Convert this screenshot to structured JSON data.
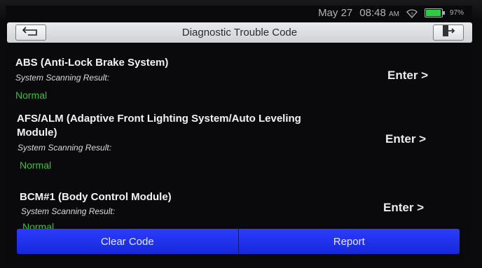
{
  "status_bar": {
    "date": "May 27",
    "time": "08:48",
    "ampm": "AM",
    "battery": "97%"
  },
  "header": {
    "title": "Diagnostic Trouble Code",
    "back_icon": "back-arrow-icon",
    "exit_icon": "exit-door-icon"
  },
  "systems": [
    {
      "name": "ABS (Anti-Lock Brake System)",
      "sub_label": "System Scanning Result:",
      "result": "Normal",
      "enter_label": "Enter >"
    },
    {
      "name_line1": "AFS/ALM (Adaptive Front Lighting System/Auto Leveling",
      "name_line2": "Module)",
      "sub_label": "System Scanning Result:",
      "result": "Normal",
      "enter_label": "Enter >"
    },
    {
      "name": "BCM#1 (Body Control Module)",
      "sub_label": "System Scanning Result:",
      "result": "Normal",
      "enter_label": "Enter >"
    }
  ],
  "actions": {
    "clear_code": "Clear Code",
    "report": "Report"
  },
  "colors": {
    "accent_blue": "#1f2fe8",
    "result_green": "#3fbf3f",
    "title_bar": "#dfe1e4"
  }
}
